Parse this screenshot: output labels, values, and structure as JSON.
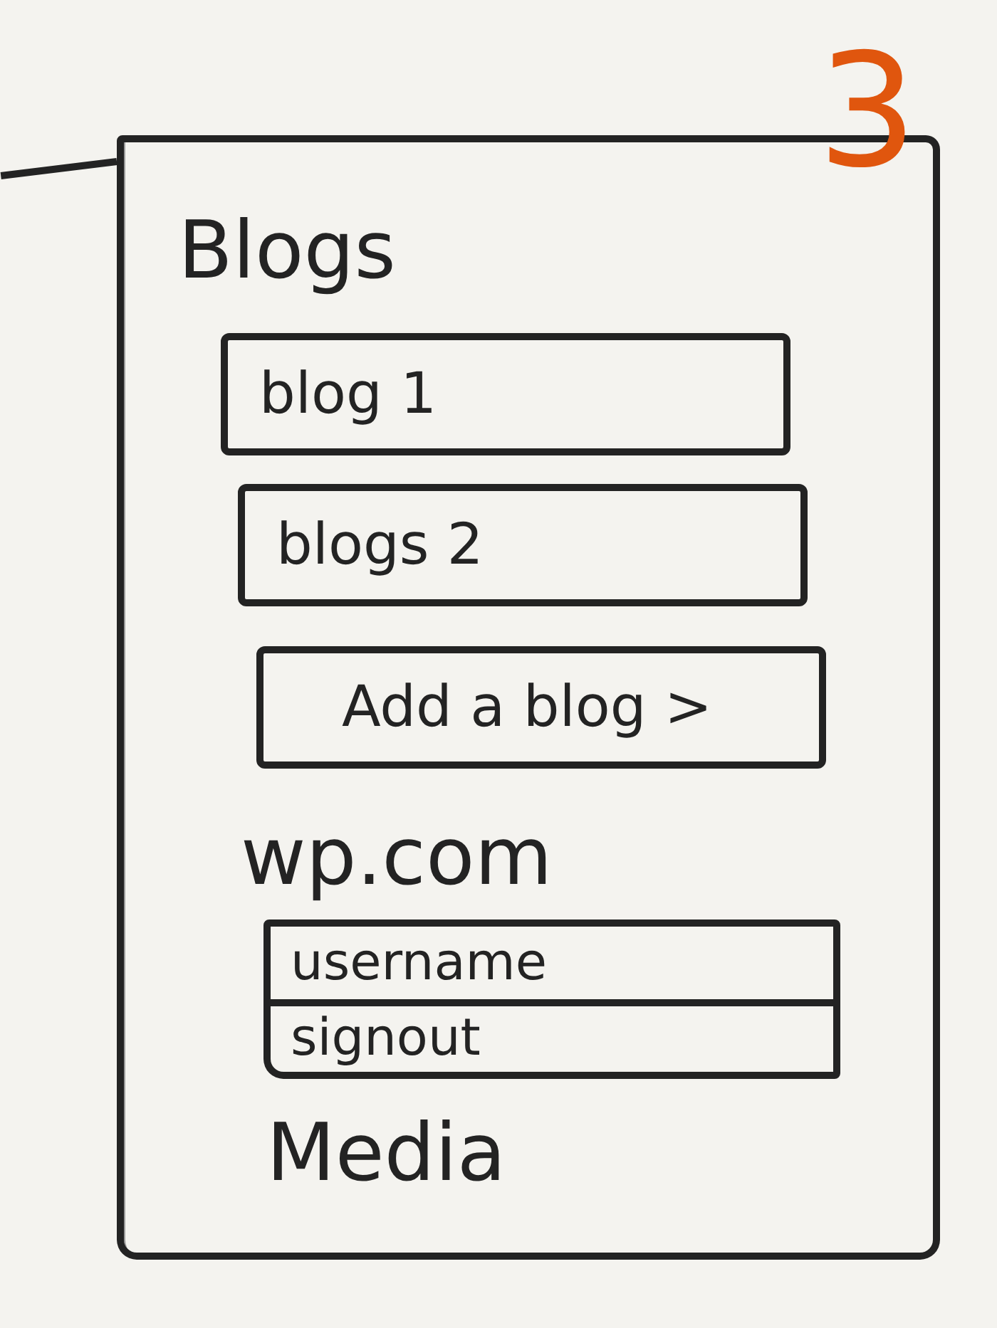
{
  "page_number": "3",
  "blogs": {
    "title": "Blogs",
    "items": [
      {
        "label": "blog 1"
      },
      {
        "label": "blogs 2"
      }
    ],
    "add_button": "Add a blog >"
  },
  "account": {
    "title": "wp.com",
    "rows": [
      {
        "label": "username"
      },
      {
        "label": "signout"
      }
    ]
  },
  "media": {
    "title": "Media"
  }
}
